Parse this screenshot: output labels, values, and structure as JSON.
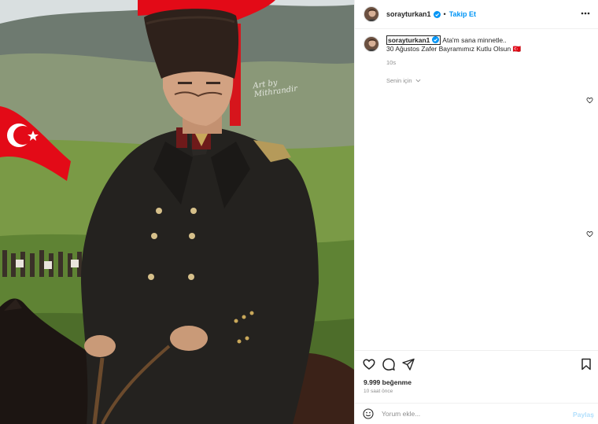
{
  "post": {
    "username": "sorayturkan1",
    "verified": true,
    "follow_label": "Takip Et",
    "separator": "•",
    "more_icon": "more-horizontal-icon"
  },
  "caption": {
    "username": "sorayturkan1",
    "line1": "Ata'm sana minnetle..",
    "line2": "30 Ağustos Zafer Bayramımız Kutlu Olsun 🇹🇷",
    "time": "10s",
    "translate_label": "Senin için"
  },
  "media": {
    "watermark": "Art by Mithrandir",
    "description_icon": "post-image"
  },
  "actions": {
    "icons": [
      "heart-icon",
      "comment-icon",
      "share-icon",
      "bookmark-icon"
    ],
    "likes": "9.999 beğenme",
    "posted_ago": "10 saat önce"
  },
  "comment": {
    "placeholder": "Yorum ekle...",
    "share_label": "Paylaş"
  },
  "colors": {
    "accent": "#0095f6",
    "accent_disabled": "#b2dffc",
    "muted": "#8e8e8e",
    "flag_red": "#e30a17"
  }
}
